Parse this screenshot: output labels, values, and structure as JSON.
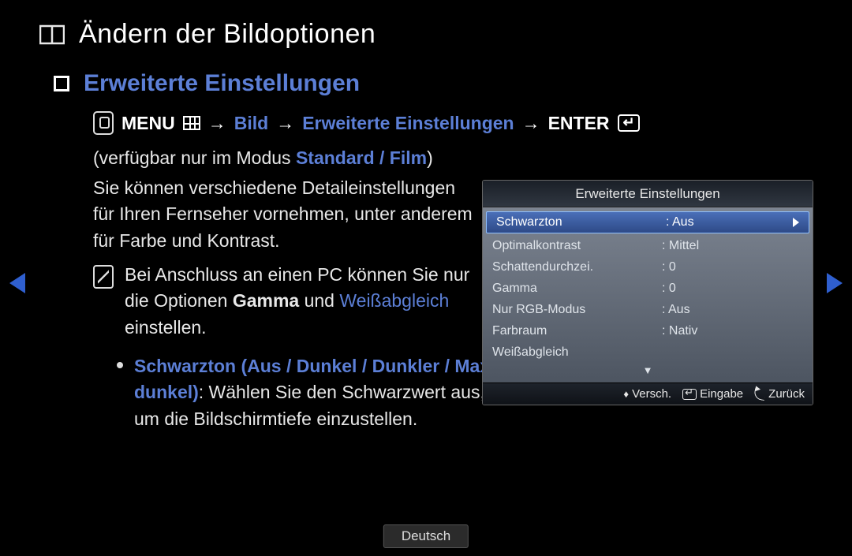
{
  "title": "Ändern der Bildoptionen",
  "section": "Erweiterte Einstellungen",
  "path": {
    "menu": "MENU",
    "item1": "Bild",
    "item2": "Erweiterte Einstellungen",
    "enter": "ENTER"
  },
  "availability": {
    "prefix": "(verfügbar nur im Modus ",
    "modes": "Standard / Film",
    "suffix": ")"
  },
  "paragraph": "Sie können verschiedene Detaileinstellungen für Ihren Fernseher vornehmen, unter anderem für Farbe und Kontrast.",
  "note": {
    "part1": "Bei Anschluss an einen PC können Sie nur die Optionen ",
    "gamma": "Gamma",
    "and": " und ",
    "weiss": "Weißabgleich",
    "part2": " einstellen."
  },
  "bullet": {
    "opt_label": "Schwarzton (Aus / Dunkel / Dunkler / Max. dunkel)",
    "desc": ": Wählen Sie den Schwarzwert aus, um die Bildschirmtiefe einzustellen."
  },
  "osd": {
    "title": "Erweiterte Einstellungen",
    "rows": [
      {
        "label": "Schwarzton",
        "value": ": Aus",
        "selected": true
      },
      {
        "label": "Optimalkontrast",
        "value": ": Mittel",
        "selected": false
      },
      {
        "label": "Schattendurchzei.",
        "value": ": 0",
        "selected": false
      },
      {
        "label": "Gamma",
        "value": ": 0",
        "selected": false
      },
      {
        "label": "Nur RGB-Modus",
        "value": ": Aus",
        "selected": false
      },
      {
        "label": "Farbraum",
        "value": ": Nativ",
        "selected": false
      },
      {
        "label": "Weißabgleich",
        "value": "",
        "selected": false
      }
    ],
    "footer": {
      "move": "Versch.",
      "enter": "Eingabe",
      "back": "Zurück"
    },
    "scroll_indicator": "▼"
  },
  "language": "Deutsch",
  "arrow_sep": "→"
}
